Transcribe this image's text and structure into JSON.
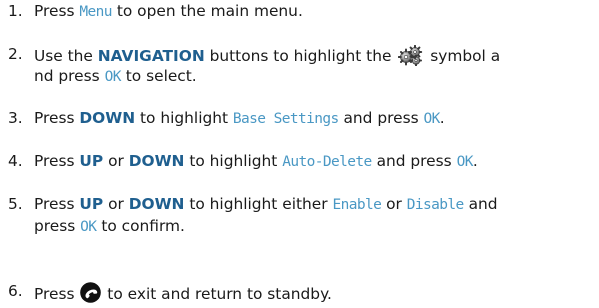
{
  "steps": [
    {
      "num": "1.",
      "text1": "Press ",
      "lcd1": "Menu",
      "text2": " to open the main menu."
    },
    {
      "num": "2.",
      "text1": "Use the ",
      "kw1": "NAVIGATION",
      "text2": " buttons to highlight the ",
      "text3": " symbol a",
      "line2_text1": "nd press ",
      "line2_lcd1": "OK",
      "line2_text2": " to select.",
      "icon": "settings-gears-icon"
    },
    {
      "num": "3.",
      "text1": "Press ",
      "kw1": "DOWN",
      "text2": " to highlight ",
      "lcd1": "Base Settings",
      "text3": " and press ",
      "lcd2": "OK",
      "text4": "."
    },
    {
      "num": "4.",
      "text1": "Press ",
      "kw1": "UP",
      "text2": " or ",
      "kw2": "DOWN",
      "text3": " to highlight ",
      "lcd1": "Auto-Delete",
      "text4": " and press ",
      "lcd2": "OK",
      "text5": "."
    },
    {
      "num": "5.",
      "text1": "Press ",
      "kw1": "UP",
      "text2": " or ",
      "kw2": "DOWN",
      "text3": " to highlight either ",
      "lcd1": "Enable",
      "text4": " or ",
      "lcd2": "Disable",
      "text5": " and",
      "line2_text1": "press ",
      "line2_lcd1": "OK",
      "line2_text2": " to confirm."
    },
    {
      "num": "6.",
      "text1": "Press ",
      "text2": " to exit and return to standby.",
      "icon": "end-call-icon"
    }
  ],
  "colors": {
    "keyword": "#1f5f8f",
    "lcd_text": "#4a98c4",
    "body_text": "#1a1a1a"
  }
}
